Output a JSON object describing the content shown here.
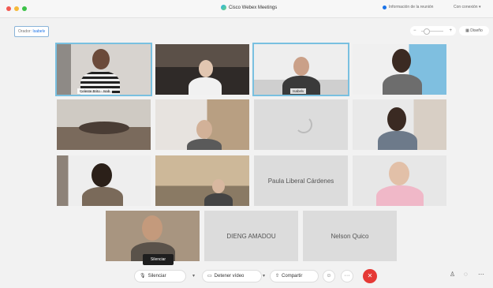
{
  "window": {
    "title": "Cisco Webex Meetings",
    "meeting_info": "Información de la reunión",
    "connection": "Con conexión"
  },
  "speaker_bar": {
    "label": "Orador:",
    "name": "Isabelv"
  },
  "view": {
    "zoom_minus": "−",
    "zoom_plus": "+",
    "layout_label": "Diseño"
  },
  "participants": [
    {
      "name": "Celeste Brito",
      "label": "Celeste Brito · Isab"
    },
    {
      "name": ""
    },
    {
      "name": "Isabelv",
      "label": "Isabelv"
    },
    {
      "name": ""
    },
    {
      "name": ""
    },
    {
      "name": ""
    },
    {
      "name": ""
    },
    {
      "name": ""
    },
    {
      "name": ""
    },
    {
      "name": ""
    },
    {
      "name": "Paula Liberal Cárdenes",
      "label": "Paula Liberal Cárdenes"
    },
    {
      "name": ""
    },
    {
      "name": ""
    },
    {
      "name": "DIENG AMADOU",
      "label": "DIENG AMADOU"
    },
    {
      "name": "Nelson Quico",
      "label": "Nelson Quico"
    }
  ],
  "tooltip": "Silenciar",
  "controls": {
    "mute": "Silenciar",
    "stop_video": "Detener vídeo",
    "share": "Compartir",
    "more": "···",
    "end": "✕"
  },
  "icons": {
    "mute": "mic-icon",
    "video": "camera-icon",
    "share": "share-icon",
    "reactions": "smiley-icon",
    "participants": "participants-icon",
    "chat": "chat-icon",
    "end": "end-call-icon"
  },
  "colors": {
    "active_speaker_border": "#79c0e0",
    "end_button": "#e53935",
    "tooltip_bg": "#1e1e1e"
  }
}
